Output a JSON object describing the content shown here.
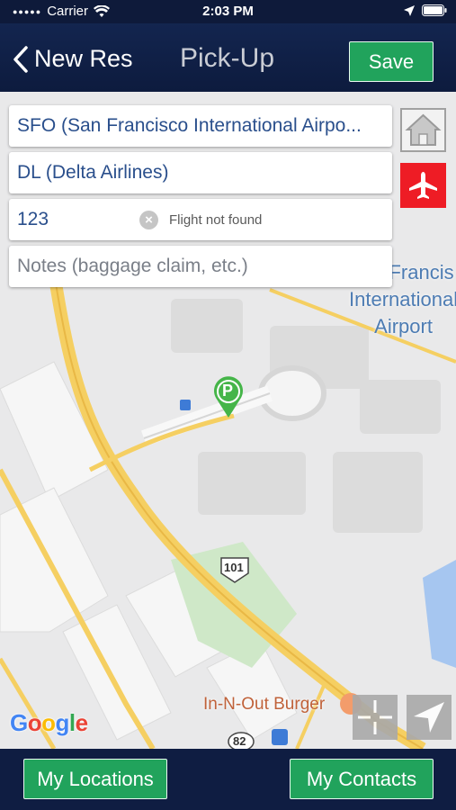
{
  "status_bar": {
    "carrier": "Carrier",
    "time": "2:03 PM"
  },
  "nav": {
    "back_label": "New Res",
    "title": "Pick-Up",
    "save_label": "Save"
  },
  "form": {
    "airport": "SFO (San Francisco International Airpo...",
    "airline": "DL (Delta Airlines)",
    "flight_number": "123",
    "flight_status": "Flight not found",
    "notes_placeholder": "Notes (baggage claim, etc.)"
  },
  "map": {
    "airport_label_line1": "Francis",
    "airport_label_line2": "International",
    "airport_label_line3": "Airport",
    "restaurant_label": "In-N-Out Burger",
    "highway_101": "101",
    "highway_82": "82",
    "pin_letter": "P",
    "attribution": "Google",
    "colors": {
      "road": "#f5cf62",
      "water": "#a6c6f0",
      "park": "#cfe8c8",
      "pin": "#45b549",
      "label": "#4d7cb3"
    }
  },
  "bottom": {
    "locations_label": "My Locations",
    "contacts_label": "My Contacts"
  },
  "icons": [
    "wifi-icon",
    "location-arrow-icon",
    "battery-icon",
    "back-chevron-icon",
    "home-icon",
    "airplane-icon",
    "clear-icon",
    "crosshair-icon",
    "navigation-arrow-icon"
  ]
}
